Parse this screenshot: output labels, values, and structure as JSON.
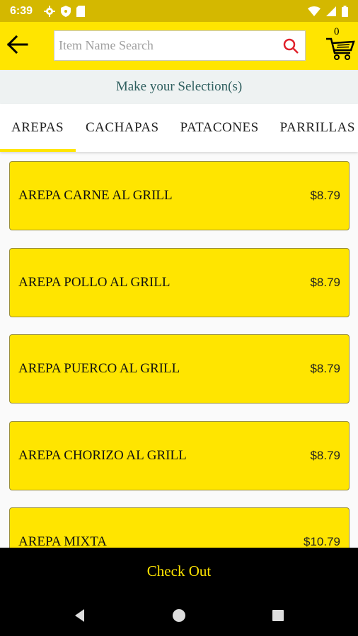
{
  "status_bar": {
    "time": "6:39",
    "left_icons": [
      "gear-icon",
      "shield-icon",
      "sd-card-icon"
    ],
    "right_icons": [
      "wifi-icon",
      "signal-icon",
      "battery-icon"
    ]
  },
  "toolbar": {
    "back_icon": "arrow-left-icon",
    "search_placeholder": "Item Name Search",
    "search_value": "",
    "cart_count": "0"
  },
  "selection_prompt": "Make your Selection(s)",
  "tabs": [
    {
      "label": "AREPAS",
      "active": true
    },
    {
      "label": "CACHAPAS",
      "active": false
    },
    {
      "label": "PATACONES",
      "active": false
    },
    {
      "label": "PARRILLAS",
      "active": false
    }
  ],
  "items": [
    {
      "name": "AREPA CARNE AL GRILL",
      "price": "$8.79"
    },
    {
      "name": "AREPA POLLO AL GRILL",
      "price": "$8.79"
    },
    {
      "name": "AREPA PUERCO AL GRILL",
      "price": "$8.79"
    },
    {
      "name": "AREPA CHORIZO AL GRILL",
      "price": "$8.79"
    },
    {
      "name": "AREPA MIXTA",
      "price": "$10.79"
    }
  ],
  "checkout_label": "Check Out",
  "colors": {
    "accent": "#ffe500",
    "status_bar": "#d4b800",
    "checkout_bg": "#000000",
    "search_icon": "#e0202a"
  }
}
